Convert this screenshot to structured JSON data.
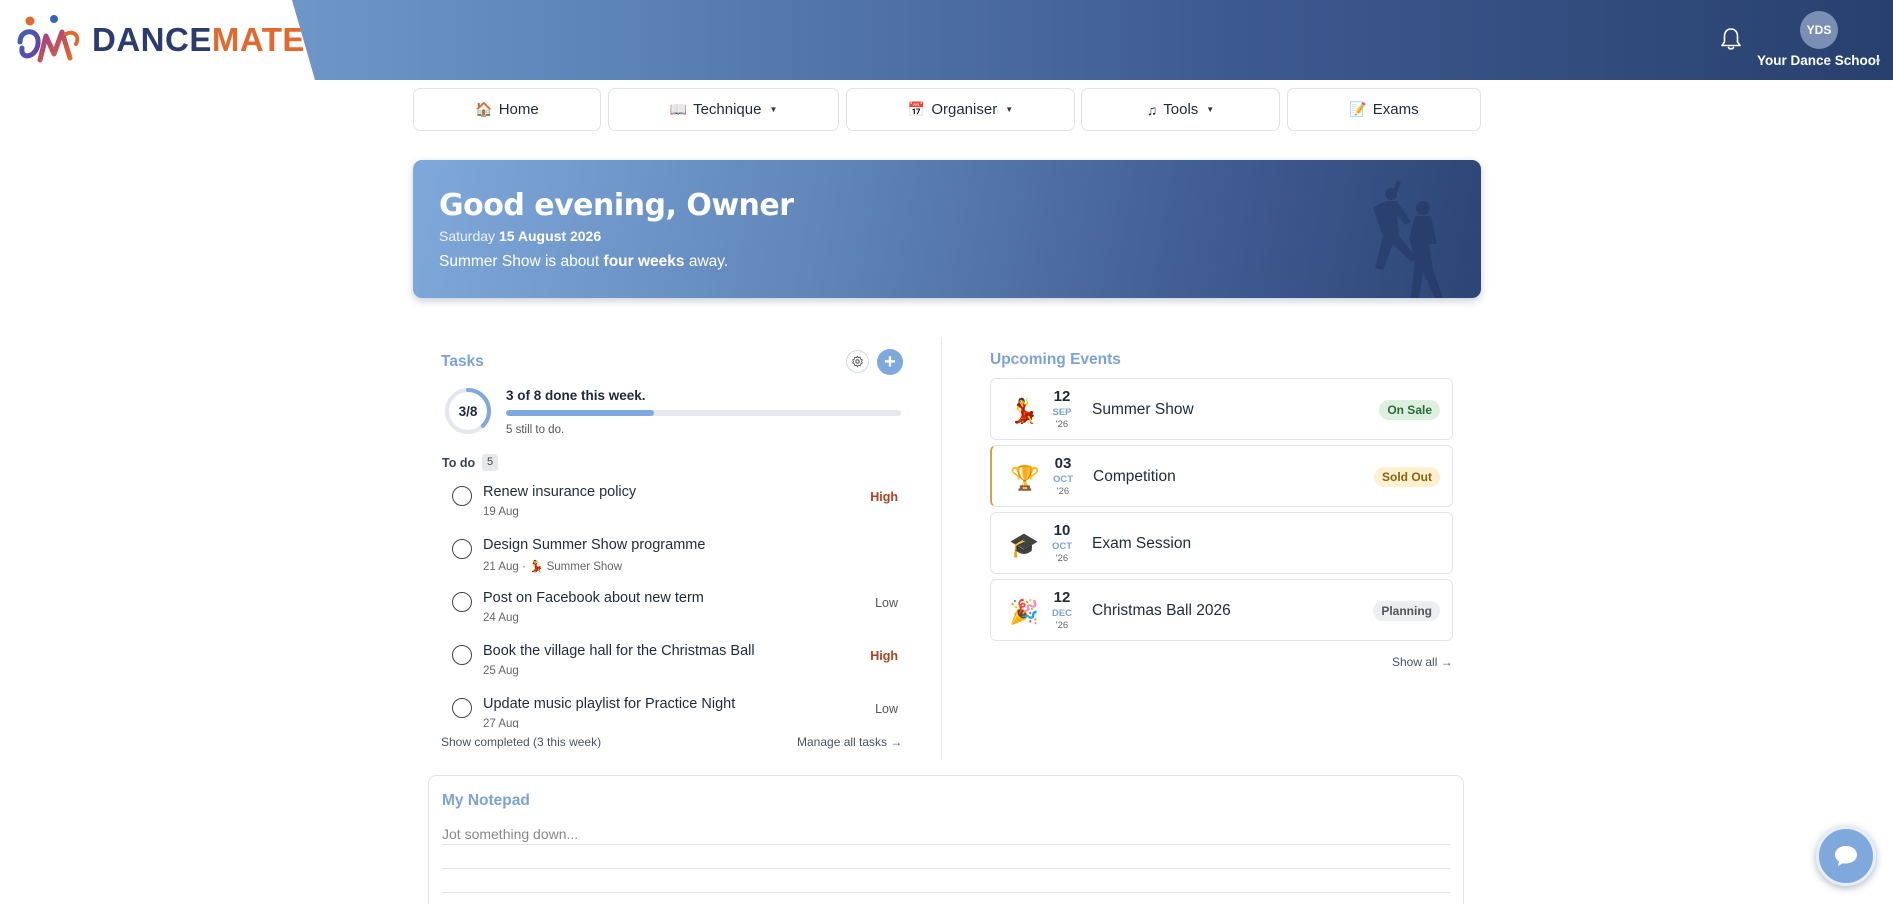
{
  "brand": {
    "dance": "DANCE",
    "mate": "MATE"
  },
  "header": {
    "avatar_initials": "YDS",
    "school_name": "Your Dance School"
  },
  "nav": [
    {
      "label": "Home",
      "icon": "🏠"
    },
    {
      "label": "Technique",
      "icon": "📖"
    },
    {
      "label": "Organiser",
      "icon": "📅"
    },
    {
      "label": "Tools",
      "icon": "♫"
    },
    {
      "label": "Exams",
      "icon": "📝"
    }
  ],
  "hero": {
    "greeting": "Good evening, Owner",
    "weekday": "Saturday",
    "date": "15 August 2026",
    "sub_prefix": "Summer Show is about ",
    "sub_bold": "four weeks",
    "sub_suffix": " away."
  },
  "tasks": {
    "title": "Tasks",
    "ring_label": "3/8",
    "done": 3,
    "total": 8,
    "progress_text": "3 of 8 done this week.",
    "still_text": "5 still to do.",
    "todo_label": "To do",
    "todo_count": "5",
    "items": [
      {
        "title": "Renew insurance policy",
        "date": "19 Aug",
        "event": "",
        "priority": "High"
      },
      {
        "title": "Design Summer Show programme",
        "date": "21 Aug",
        "event": "Summer Show",
        "priority": ""
      },
      {
        "title": "Post on Facebook about new term",
        "date": "24 Aug",
        "event": "",
        "priority": "Low"
      },
      {
        "title": "Book the village hall for the Christmas Ball",
        "date": "25 Aug",
        "event": "",
        "priority": "High"
      },
      {
        "title": "Update music playlist for Practice Night",
        "date": "27 Aug",
        "event": "",
        "priority": "Low"
      }
    ],
    "show_completed": "Show completed (3 this week)",
    "manage_all": "Manage all tasks →"
  },
  "events": {
    "title": "Upcoming Events",
    "items": [
      {
        "icon": "💃",
        "day": "12",
        "month": "SEP",
        "year": "'26",
        "name": "Summer Show",
        "badge": "On Sale",
        "badge_type": "onsale"
      },
      {
        "icon": "🏆",
        "day": "03",
        "month": "OCT",
        "year": "'26",
        "name": "Competition",
        "badge": "Sold Out",
        "badge_type": "soldout"
      },
      {
        "icon": "🎓",
        "day": "10",
        "month": "OCT",
        "year": "'26",
        "name": "Exam Session",
        "badge": "",
        "badge_type": ""
      },
      {
        "icon": "🎉",
        "day": "12",
        "month": "DEC",
        "year": "'26",
        "name": "Christmas Ball 2026",
        "badge": "Planning",
        "badge_type": "planning"
      }
    ],
    "show_all": "Show all →"
  },
  "notepad": {
    "title": "My Notepad",
    "placeholder": "Jot something down..."
  },
  "colors": {
    "accent": "#7fa8dc",
    "header_dark": "#28406e",
    "brand_orange": "#e2692d",
    "brand_navy": "#2b3c6e",
    "priority_high": "#b0401f"
  }
}
